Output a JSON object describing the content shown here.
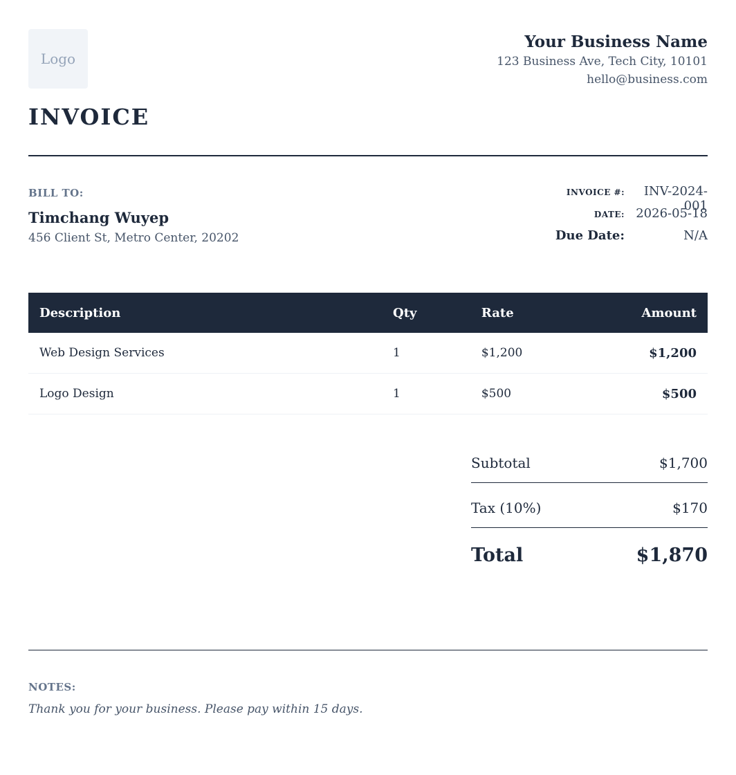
{
  "logo": {
    "label": "Logo"
  },
  "document": {
    "title": "INVOICE"
  },
  "business": {
    "name": "Your Business Name",
    "address": "123 Business Ave, Tech City, 10101",
    "email": "hello@business.com"
  },
  "bill_to": {
    "label": "BILL TO:",
    "name": "Timchang Wuyep",
    "address": "456 Client St, Metro Center, 20202"
  },
  "meta": {
    "invoice_number_label": "INVOICE #:",
    "invoice_number": "INV-2024-001",
    "date_label": "DATE:",
    "date": "2026-05-18",
    "due_date_label": "Due Date:",
    "due_date": "N/A"
  },
  "table": {
    "headers": {
      "description": "Description",
      "qty": "Qty",
      "rate": "Rate",
      "amount": "Amount"
    },
    "rows": [
      {
        "description": "Web Design Services",
        "qty": "1",
        "rate": "$1,200",
        "amount": "$1,200"
      },
      {
        "description": "Logo Design",
        "qty": "1",
        "rate": "$500",
        "amount": "$500"
      }
    ]
  },
  "totals": {
    "subtotal_label": "Subtotal",
    "subtotal": "$1,700",
    "tax_label": "Tax (10%)",
    "tax": "$170",
    "total_label": "Total",
    "total": "$1,870"
  },
  "notes": {
    "label": "NOTES:",
    "text": "Thank you for your business. Please pay within 15 days."
  }
}
